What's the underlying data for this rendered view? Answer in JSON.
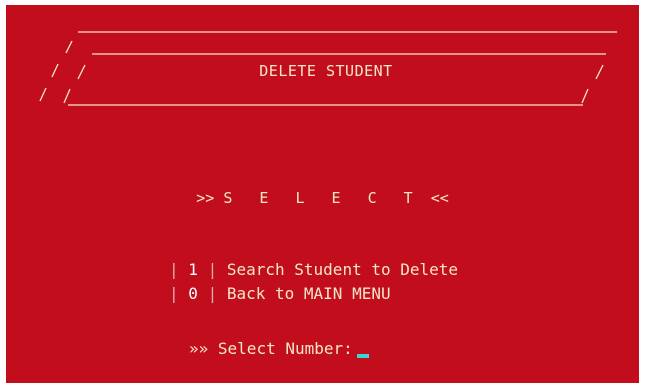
{
  "window": {
    "background": "#c20e1c",
    "text_color": "#f5e6c8",
    "cursor_color": "#3ad6d6"
  },
  "banner": {
    "title": "DELETE STUDENT"
  },
  "select": {
    "left_marker": ">>",
    "word": "S E L E C T",
    "right_marker": "<<"
  },
  "menu": {
    "items": [
      {
        "number": "1",
        "label": "Search Student to Delete"
      },
      {
        "number": "0",
        "label": "Back to MAIN MENU"
      }
    ]
  },
  "prompt": {
    "marker": "»»",
    "label": "Select Number:"
  }
}
